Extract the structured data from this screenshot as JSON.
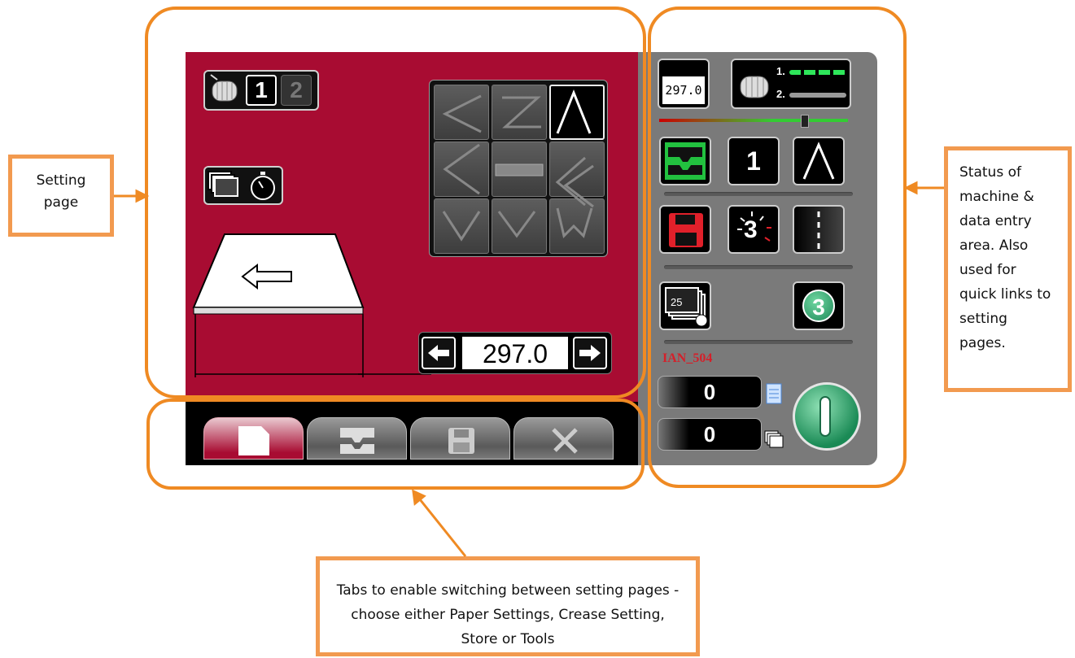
{
  "callouts": {
    "setting_page": "Setting page",
    "status_area": "Status of machine & data entry area. Also used for quick links to setting pages.",
    "tabs": "Tabs to enable switching between setting pages - choose either Paper Settings, Crease Setting, Store or Tools"
  },
  "setting_page": {
    "station_1_label": "1",
    "station_2_label": "2",
    "length_value": "297.0",
    "crease_grid_icons": [
      "left-angle-icon",
      "z-fold-icon",
      "peak-icon",
      "z-icon",
      "ruler-icon",
      "double-angle-icon",
      "v-trough-icon",
      "v-notch-icon",
      "clamp-icon"
    ],
    "selected_crease": "peak-icon"
  },
  "status_panel": {
    "paper_length": "297.0",
    "station_1_marker": "1.",
    "station_2_marker": "2.",
    "station_count": "1",
    "batch_count": "3",
    "stack_count": "25",
    "job_count": "3",
    "job_name": "IAN_504",
    "sheet_counter": "0",
    "stack_counter": "0",
    "accent_red": "#a80c32",
    "accent_green": "#22c13f"
  },
  "tabs": [
    "paper-settings",
    "crease-setting",
    "store",
    "tools"
  ],
  "active_tab": "paper-settings"
}
